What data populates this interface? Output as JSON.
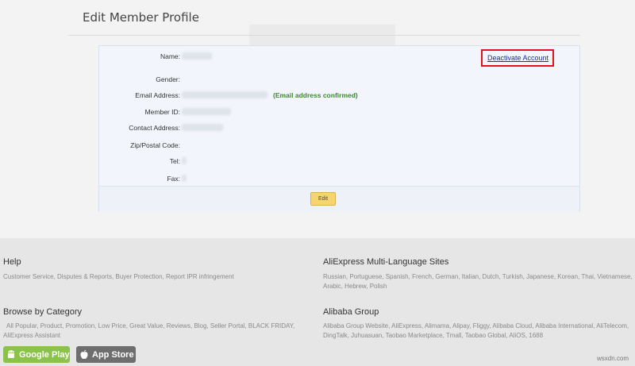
{
  "page": {
    "title": "Edit Member Profile"
  },
  "profile": {
    "fields": [
      {
        "label": "Name:"
      },
      {
        "label": "Gender:"
      },
      {
        "label": "Email Address:",
        "note": "(Email address confirmed)"
      },
      {
        "label": "Member ID:"
      },
      {
        "label": "Contact Address:"
      },
      {
        "label": "Zip/Postal Code:"
      },
      {
        "label": "Tel:"
      },
      {
        "label": "Fax:"
      }
    ],
    "deactivate_label": "Deactivate Account",
    "edit_label": "Edit"
  },
  "footer": {
    "help": {
      "heading": "Help",
      "text": "Customer Service, Disputes & Reports, Buyer Protection, Report IPR infringement"
    },
    "browse": {
      "heading": "Browse by Category",
      "text": "All Popular, Product, Promotion, Low Price, Great Value, Reviews, Blog, Seller Portal, BLACK FRIDAY, AliExpress Assistant"
    },
    "multilang": {
      "heading": "AliExpress Multi-Language Sites",
      "text": "Russian, Portuguese, Spanish, French, German, Italian, Dutch, Turkish, Japanese, Korean, Thai, Vietnamese, Arabic, Hebrew, Polish"
    },
    "alibaba": {
      "heading": "Alibaba Group",
      "text": "Alibaba Group Website, AliExpress, Alimama, Alipay, Fliggy, Alibaba Cloud, Alibaba International, AliTelecom, DingTalk, Juhuasuan, Taobao Marketplace, Tmall, Taobao Global, AliOS, 1688"
    },
    "google_play": "Google Play",
    "app_store": "App Store"
  },
  "watermark": "wsxdn.com",
  "colors": {
    "highlight": "#e0141e",
    "confirmed": "#3b8a2c",
    "google_play": "#8bc34a",
    "app_store": "#6e6e6e"
  }
}
